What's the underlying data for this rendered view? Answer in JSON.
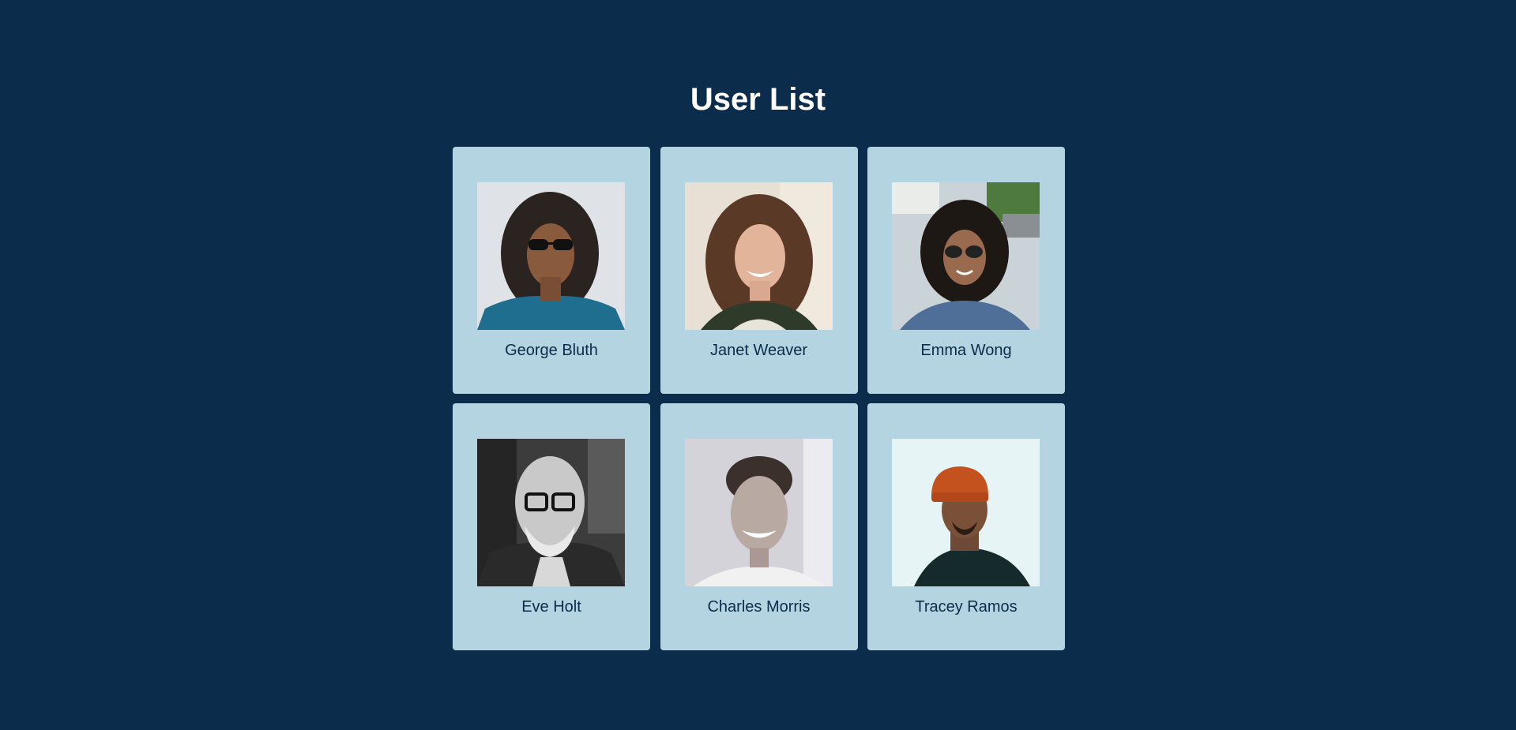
{
  "header": {
    "title": "User List"
  },
  "users": [
    {
      "name": "George Bluth",
      "avatar_icon": "person-photo-icon"
    },
    {
      "name": "Janet Weaver",
      "avatar_icon": "person-photo-icon"
    },
    {
      "name": "Emma Wong",
      "avatar_icon": "person-photo-icon"
    },
    {
      "name": "Eve Holt",
      "avatar_icon": "person-photo-icon"
    },
    {
      "name": "Charles Morris",
      "avatar_icon": "person-photo-icon"
    },
    {
      "name": "Tracey Ramos",
      "avatar_icon": "person-photo-icon"
    }
  ],
  "colors": {
    "background": "#0b2c4a",
    "card": "#b3d4e0",
    "title_text": "#ffffff",
    "name_text": "#0b2c4a"
  }
}
